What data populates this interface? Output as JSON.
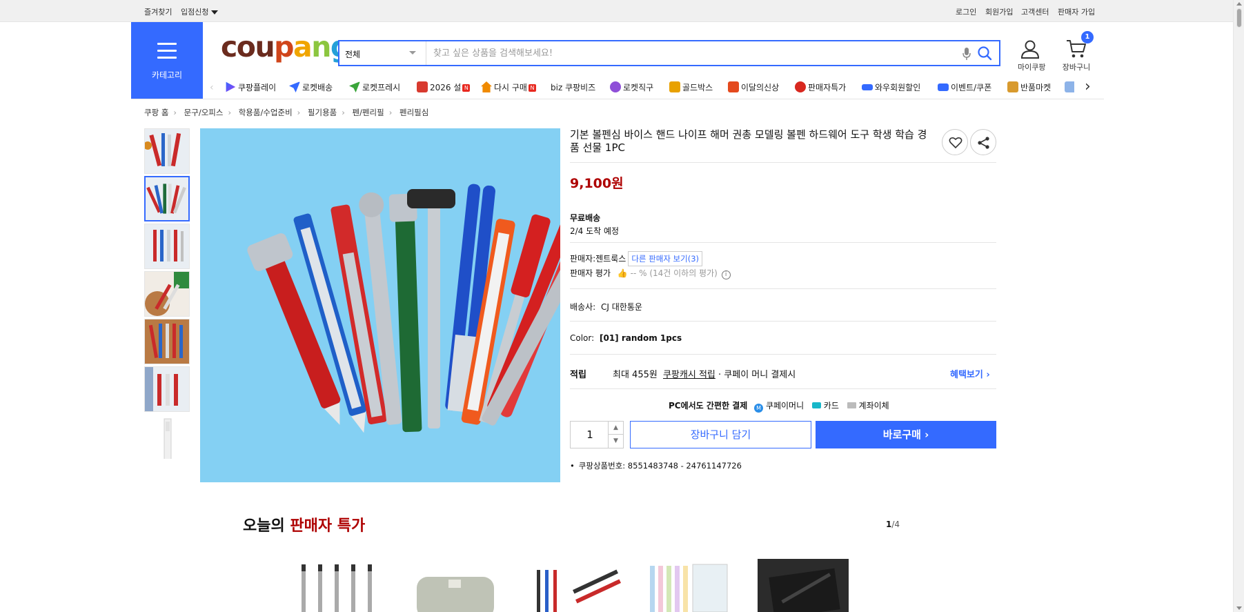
{
  "topbar": {
    "left_links": [
      "즐겨찾기",
      "입점신청"
    ],
    "right_links": [
      "로그인",
      "회원가입",
      "고객센터",
      "판매자 가입"
    ]
  },
  "header": {
    "category_label": "카테고리",
    "logo_text": [
      "cou",
      "p",
      "a",
      "n",
      "g"
    ],
    "search_category": "전체",
    "search_placeholder": "찾고 싶은 상품을 검색해보세요!",
    "mypage_label": "마이쿠팡",
    "cart_label": "장바구니",
    "cart_count": "1"
  },
  "quicknav": [
    {
      "label": "쿠팡플레이",
      "icon": "play-icon",
      "color": "#346aff"
    },
    {
      "label": "로켓배송",
      "icon": "rocket-icon",
      "color": "#346aff"
    },
    {
      "label": "로켓프레시",
      "icon": "rocket-fresh-icon",
      "color": "#3aa53a"
    },
    {
      "label": "2026 설",
      "icon": "gift-icon",
      "color": "#d83a2f",
      "new": true
    },
    {
      "label": "다시 구매",
      "icon": "reorder-icon",
      "color": "#f08a00",
      "new": true
    },
    {
      "label": "biz 쿠팡비즈",
      "icon": "biz-icon",
      "color": "#b88a2e"
    },
    {
      "label": "로켓직구",
      "icon": "rocket-global-icon",
      "color": "#8f4fd8"
    },
    {
      "label": "골드박스",
      "icon": "goldbox-icon",
      "color": "#e8a100"
    },
    {
      "label": "이달의신상",
      "icon": "bag-icon",
      "color": "#e44a1e"
    },
    {
      "label": "판매자특가",
      "icon": "percent-icon",
      "color": "#d8281f"
    },
    {
      "label": "와우회원할인",
      "icon": "wow-icon",
      "color": "#346aff"
    },
    {
      "label": "이벤트/쿠폰",
      "icon": "coupon-icon",
      "color": "#346aff"
    },
    {
      "label": "반품마켓",
      "icon": "return-market-icon",
      "color": "#d89a2e"
    }
  ],
  "nav_new_badge": "N",
  "breadcrumb": [
    "쿠팡 홈",
    "문구/오피스",
    "학용품/수업준비",
    "필기용품",
    "펜/펜리필",
    "펜리필심"
  ],
  "product": {
    "title": "기본 볼펜심 바이스 핸드 나이프 해머 권총 모델링 볼펜 하드웨어 도구 학생 학습 경품 선물 1PC",
    "price": "9,100원",
    "shipping_type": "무료배송",
    "arrival": "2/4 도착 예정",
    "seller_label": "판매자:",
    "seller_name": "젠트룩스",
    "other_sellers": "다른 판매자 보기(3)",
    "seller_rating_label": "판매자 평가",
    "seller_rating_value": "-- % (14건 이하의 평가)",
    "courier_label": "배송사:",
    "courier_name": "CJ 대한통운",
    "color_label": "Color:",
    "color_value": "[01] random 1pcs",
    "reward_label": "적립",
    "reward_prefix": "최대 455원",
    "reward_link": "쿠팡캐시 적립",
    "reward_suffix": "· 쿠페이 머니 결제시",
    "benefit_link": "혜택보기",
    "pay_title": "PC에서도 간편한 결제",
    "pay_methods": [
      "쿠페이머니",
      "카드",
      "계좌이체"
    ],
    "quantity": "1",
    "cart_button": "장바구니 담기",
    "buy_button": "바로구매",
    "product_no": "쿠팡상품번호: 8551483748 - 24761147726"
  },
  "deals": {
    "title_prefix": "오늘의",
    "title_highlight": "판매자 특가",
    "page_current": "1",
    "page_total": "/4"
  },
  "colors": {
    "primary": "#346aff",
    "price_red": "#ae0000"
  }
}
